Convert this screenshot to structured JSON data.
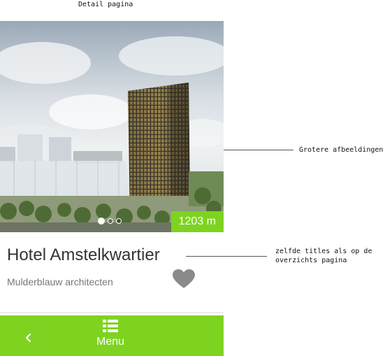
{
  "annotations": {
    "page_label": "Detail pagina",
    "images_note": "Grotere afbeeldingen",
    "titles_note": "zelfde titles als op de\noverzichts pagina"
  },
  "hero": {
    "height_badge": "1203 m",
    "carousel": {
      "count": 3,
      "active_index": 0
    }
  },
  "project": {
    "title": "Hotel Amstelkwartier",
    "architect": "Mulderblauw architecten"
  },
  "icons": {
    "favorite": "heart-icon",
    "back": "chevron-left-icon",
    "menu": "list-icon"
  },
  "bottom_bar": {
    "menu_label": "Menu"
  },
  "colors": {
    "accent": "#7ed321",
    "heart": "#8a8a8a",
    "title_text": "#333333",
    "subtitle_text": "#777777"
  }
}
